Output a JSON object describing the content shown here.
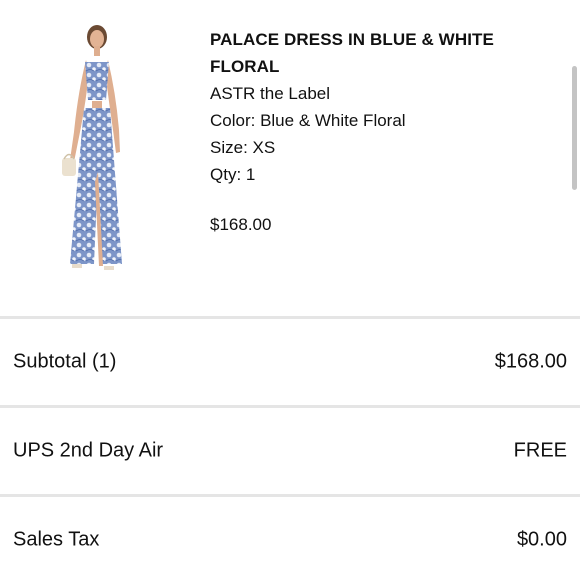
{
  "product": {
    "name": "PALACE DRESS IN BLUE & WHITE FLORAL",
    "brand": "ASTR the Label",
    "color": "Color: Blue & White Floral",
    "size": "Size: XS",
    "qty": "Qty: 1",
    "price": "$168.00"
  },
  "summary": {
    "subtotal": {
      "label": "Subtotal (1)",
      "value": "$168.00"
    },
    "shipping": {
      "label": "UPS 2nd Day Air",
      "value": "FREE"
    },
    "tax": {
      "label": "Sales Tax",
      "value": "$0.00"
    }
  },
  "colors": {
    "dress_primary": "#5a78b8",
    "dress_light": "#dfe6f3",
    "divider": "#e5e5e5"
  }
}
